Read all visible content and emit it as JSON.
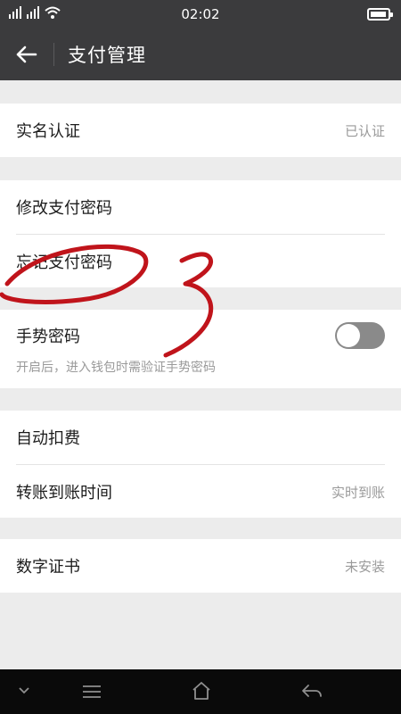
{
  "status_bar": {
    "time": "02:02"
  },
  "header": {
    "title": "支付管理",
    "back_icon": "arrow-left-icon"
  },
  "sections": {
    "identity": {
      "label": "实名认证",
      "value": "已认证"
    },
    "password": {
      "modify_label": "修改支付密码",
      "forgot_label": "忘记支付密码"
    },
    "gesture": {
      "label": "手势密码",
      "subtitle": "开启后，进入钱包时需验证手势密码",
      "toggle_on": false
    },
    "payments": {
      "auto_debit_label": "自动扣费",
      "transfer_label": "转账到账时间",
      "transfer_value": "实时到账"
    },
    "certificate": {
      "label": "数字证书",
      "value": "未安装"
    }
  },
  "annotation": {
    "text": "3",
    "color": "#c0141b"
  },
  "nav_bar": {
    "icons": [
      "chevron-down-icon",
      "menu-icon",
      "home-icon",
      "return-icon"
    ]
  }
}
